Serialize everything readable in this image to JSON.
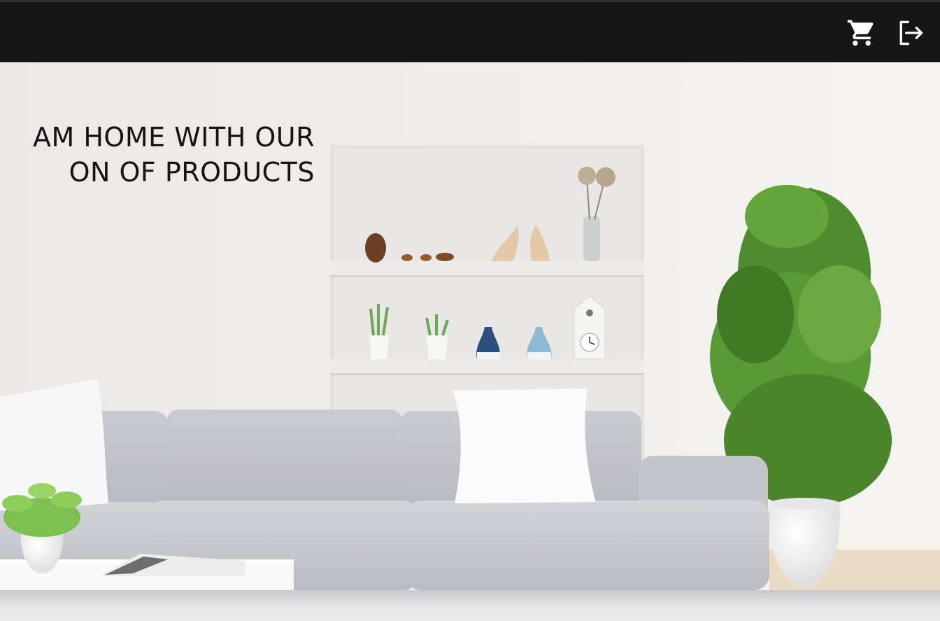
{
  "navbar": {
    "background": "#161616",
    "icons": [
      "cart-icon",
      "logout-icon"
    ]
  },
  "hero": {
    "headline_line1": "AM HOME WITH OUR",
    "headline_line2": "ON OF PRODUCTS",
    "text_color": "#141414",
    "image": "living-room-scene"
  }
}
